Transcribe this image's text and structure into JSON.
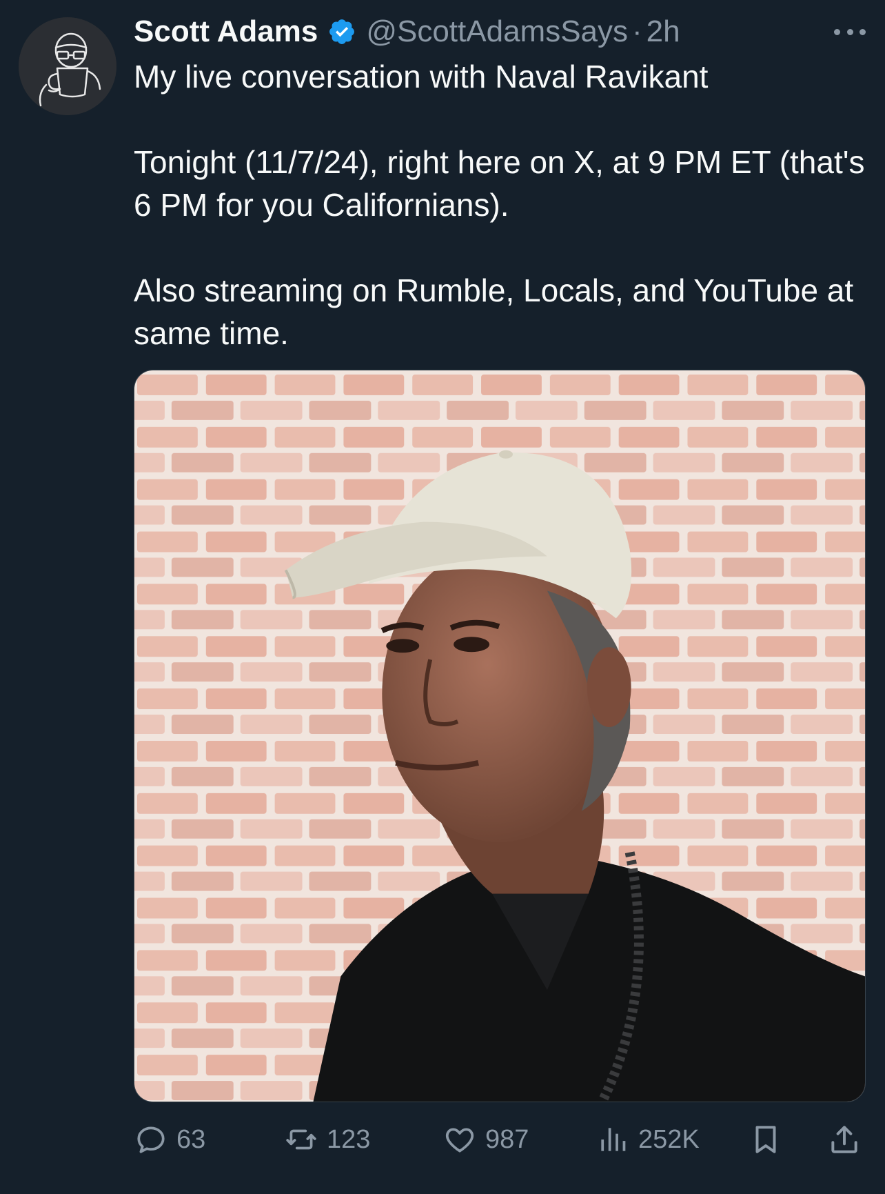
{
  "tweet": {
    "author_name": "Scott Adams",
    "handle": "@ScottAdamsSays",
    "separator": "·",
    "time": "2h",
    "paragraphs": [
      "My live conversation with Naval Ravikant",
      "Tonight (11/7/24), right here on X, at 9 PM ET (that's 6 PM for you Californians).",
      "Also streaming on Rumble, Locals, and YouTube at same time."
    ]
  },
  "actions": {
    "replies": "63",
    "reposts": "123",
    "likes": "987",
    "views": "252K"
  },
  "icons": {
    "verified": "verified-badge-icon",
    "more": "more-icon",
    "reply": "reply-icon",
    "repost": "repost-icon",
    "like": "heart-icon",
    "views": "views-icon",
    "bookmark": "bookmark-icon",
    "share": "share-icon"
  },
  "colors": {
    "background": "#15202b",
    "text": "#f7f9f9",
    "muted": "#8b98a5",
    "verified": "#1d9bf0"
  }
}
